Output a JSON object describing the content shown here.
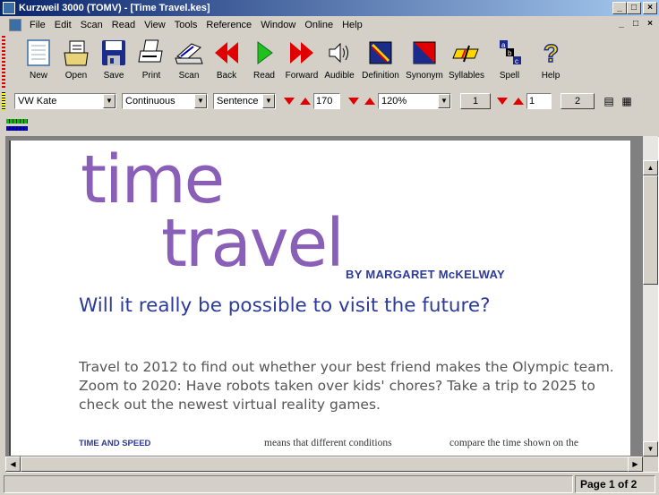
{
  "window": {
    "title": "Kurzweil 3000 (TOMV) - [Time Travel.kes]",
    "controls": {
      "minimize": "_",
      "maximize": "□",
      "close": "×"
    }
  },
  "menu": [
    "File",
    "Edit",
    "Scan",
    "Read",
    "View",
    "Tools",
    "Reference",
    "Window",
    "Online",
    "Help"
  ],
  "toolbar": {
    "buttons": [
      {
        "label": "New",
        "icon": "new-document-icon"
      },
      {
        "label": "Open",
        "icon": "open-folder-icon"
      },
      {
        "label": "Save",
        "icon": "floppy-disk-icon"
      },
      {
        "label": "Print",
        "icon": "printer-icon"
      },
      {
        "label": "Scan",
        "icon": "scanner-icon"
      },
      {
        "label": "Back",
        "icon": "rewind-icon"
      },
      {
        "label": "Read",
        "icon": "play-icon"
      },
      {
        "label": "Forward",
        "icon": "fast-forward-icon"
      },
      {
        "label": "Audible",
        "icon": "speaker-icon"
      },
      {
        "label": "Definition",
        "icon": "definition-icon"
      },
      {
        "label": "Synonym",
        "icon": "synonym-icon"
      },
      {
        "label": "Syllables",
        "icon": "syllables-icon"
      },
      {
        "label": "Spell",
        "icon": "spell-icon"
      },
      {
        "label": "Help",
        "icon": "help-question-icon"
      }
    ]
  },
  "options": {
    "voice": "VW Kate",
    "reading_mode": "Continuous",
    "reading_unit": "Sentence",
    "speed": "170",
    "zoom": "120%",
    "page_one_button": "1",
    "page_field": "1",
    "page_two_button": "2"
  },
  "document": {
    "title_line1": "time",
    "title_line2": "travel",
    "byline": "BY MARGARET McKELWAY",
    "subhead": "Will it really be possible to visit the future?",
    "intro": "Travel to 2012 to find out whether your best friend makes the Olympic team. Zoom to 2020: Have robots taken over kids' chores? Take a trip to 2025 to check out the newest virtual reality games.",
    "col1_heading": "TIME AND SPEED",
    "col2_text": "means that different conditions",
    "col3_text": "compare the time shown on the"
  },
  "status": {
    "page": "Page 1 of 2"
  },
  "colors": {
    "title_purple": "#8a5fb8",
    "heading_blue": "#2c3a9a",
    "titlebar": "#0a246a"
  }
}
